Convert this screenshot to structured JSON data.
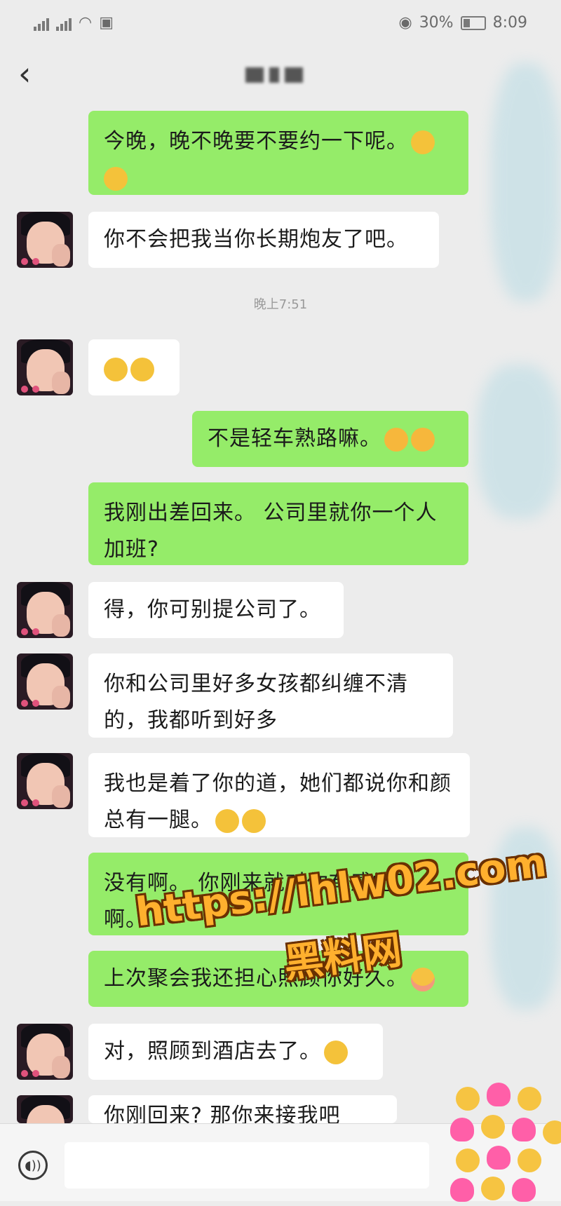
{
  "status_bar": {
    "battery_percent": "30%",
    "time": "8:09"
  },
  "header": {
    "back_icon": "chevron-left-icon"
  },
  "messages": [
    {
      "side": "out",
      "text": "今晚，晚不晚要不要约一下呢。",
      "emojis": [
        "grin",
        "grin"
      ]
    },
    {
      "side": "in",
      "text": "你不会把我当你长期炮友了吧。",
      "emojis": []
    },
    {
      "side": "in",
      "text": "",
      "emojis": [
        "pleading",
        "pleading"
      ]
    },
    {
      "side": "out",
      "text": "不是轻车熟路嘛。",
      "emojis": [
        "cry-laugh",
        "cry-laugh"
      ]
    },
    {
      "side": "out",
      "text": "我刚出差回来。 公司里就你一个人加班?",
      "emojis": []
    },
    {
      "side": "in",
      "text": "得，你可别提公司了。",
      "emojis": []
    },
    {
      "side": "in",
      "text": "你和公司里好多女孩都纠缠不清的，我都听到好多",
      "emojis": []
    },
    {
      "side": "in",
      "text": "我也是着了你的道，她们都说你和颜总有一腿。",
      "emojis": [
        "flushed",
        "flushed"
      ]
    },
    {
      "side": "out",
      "text": "没有啊。 你刚来就对你有感觉了啊。",
      "emojis": []
    },
    {
      "side": "out",
      "text": "上次聚会我还担心照顾你好久。",
      "emojis": [
        "blush"
      ]
    },
    {
      "side": "in",
      "text": "对，照顾到酒店去了。",
      "emojis": [
        "pensive"
      ]
    },
    {
      "side": "in",
      "text": "你刚回来? 那你来接我吧",
      "emojis": []
    }
  ],
  "timestamp": "晚上7:51",
  "watermark": {
    "url": "https://ihlw02.com",
    "name": "黑料网"
  },
  "input_bar": {
    "voice_icon": "voice-icon"
  }
}
